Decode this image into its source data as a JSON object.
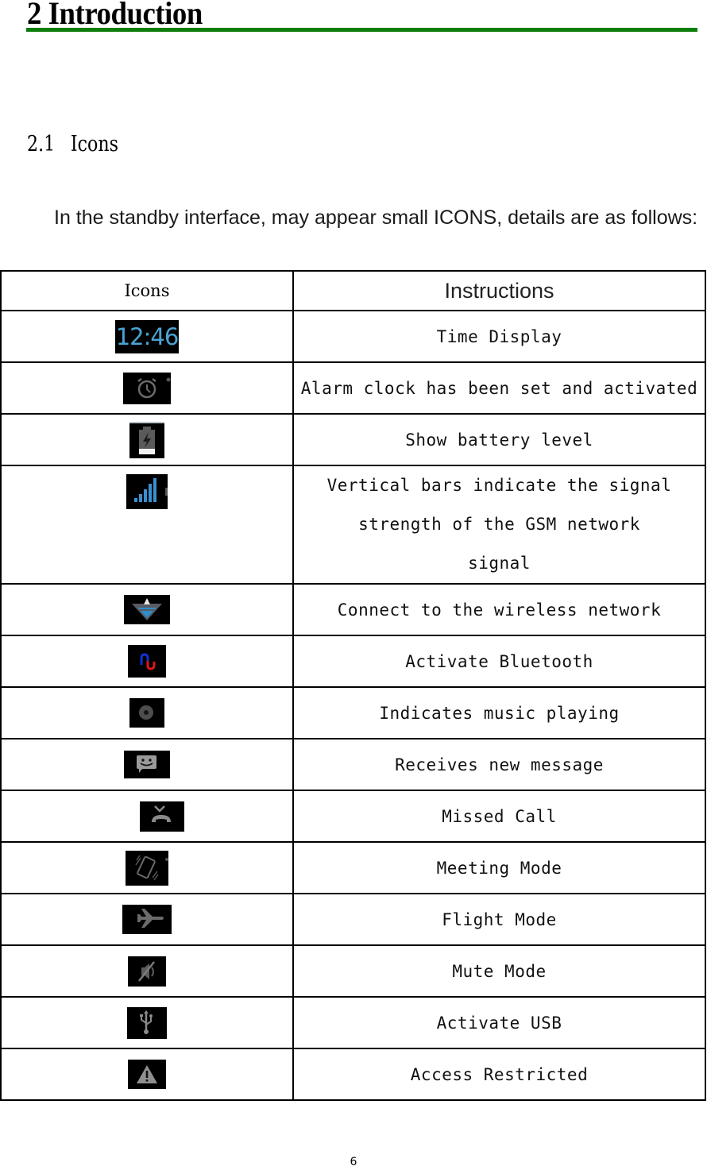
{
  "heading": {
    "text": "2 Introduction",
    "rule_color": "#0b7d0b"
  },
  "section": {
    "number": "2.1",
    "title": "Icons"
  },
  "intro": {
    "text": "In the standby interface, may appear small ICONS, details are as follows:"
  },
  "table": {
    "headers": {
      "icons": "Icons",
      "instructions": "Instructions"
    },
    "rows": [
      {
        "icon": "clock-time-icon",
        "icon_text": "12:46",
        "description": "Time Display"
      },
      {
        "icon": "alarm-clock-icon",
        "description": "Alarm clock has been set and activated"
      },
      {
        "icon": "battery-charging-icon",
        "description": "Show battery level"
      },
      {
        "icon": "signal-strength-icon",
        "description": "Vertical bars indicate the signal strength of the GSM network signal"
      },
      {
        "icon": "wifi-icon",
        "description": "Connect to the wireless network"
      },
      {
        "icon": "bluetooth-icon",
        "description": "Activate Bluetooth"
      },
      {
        "icon": "music-disc-icon",
        "description": "Indicates music playing"
      },
      {
        "icon": "message-icon",
        "description": "Receives new message"
      },
      {
        "icon": "missed-call-icon",
        "description": "Missed Call"
      },
      {
        "icon": "vibrate-icon",
        "description": "Meeting Mode"
      },
      {
        "icon": "airplane-icon",
        "description": "Flight Mode"
      },
      {
        "icon": "mute-icon",
        "description": "Mute Mode"
      },
      {
        "icon": "usb-icon",
        "description": "Activate USB"
      },
      {
        "icon": "warning-icon",
        "description": "Access Restricted"
      }
    ]
  },
  "footer": {
    "page_number": "6"
  }
}
